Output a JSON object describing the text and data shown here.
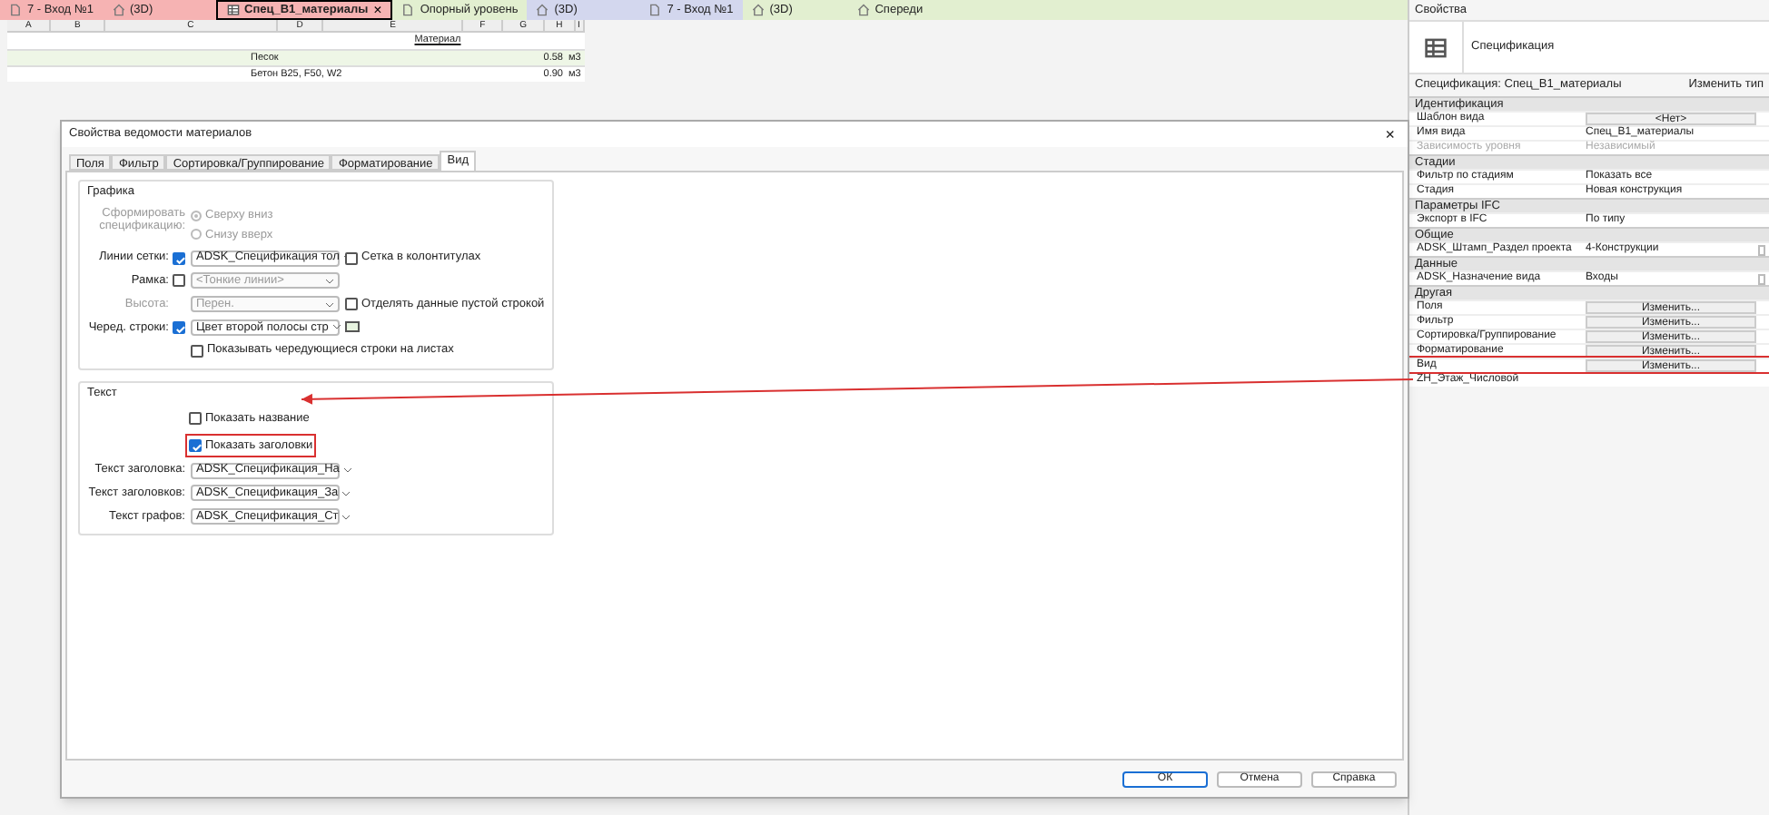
{
  "tabs": [
    {
      "label": "7 - Вход №1",
      "selected": false,
      "color": "#f6b3b3",
      "kind": "sheet"
    },
    {
      "label": "(3D)",
      "selected": false,
      "color": "#f6b3b3",
      "kind": "view3d"
    },
    {
      "label": "Спец_В1_материалы",
      "selected": true,
      "color": "#f6b3b3",
      "kind": "schedule",
      "close": "×"
    },
    {
      "label": "Опорный уровень",
      "selected": false,
      "color": "#e2efd0",
      "kind": "sheet"
    },
    {
      "label": "(3D)",
      "selected": false,
      "color": "#d3d7ee",
      "kind": "view3d"
    },
    {
      "label": "7 - Вход №1",
      "selected": false,
      "color": "#d3d7ee",
      "kind": "sheet"
    },
    {
      "label": "(3D)",
      "selected": false,
      "color": "#e2efd0",
      "kind": "view3d"
    },
    {
      "label": "Спереди",
      "selected": false,
      "color": "#e2efd0",
      "kind": "view3d"
    }
  ],
  "schedule": {
    "columns": [
      "A",
      "B",
      "C",
      "D",
      "E",
      "F",
      "G",
      "H",
      "I"
    ],
    "header": "Материал",
    "rows": [
      {
        "name": "Песок",
        "value": "0.58",
        "unit": "м3"
      },
      {
        "name": "Бетон B25, F50, W2",
        "value": "0.90",
        "unit": "м3"
      }
    ]
  },
  "dialog": {
    "title": "Свойства ведомости материалов",
    "close": "×",
    "tabs": [
      {
        "label": "Поля",
        "selected": false
      },
      {
        "label": "Фильтр",
        "selected": false
      },
      {
        "label": "Сортировка/Группирование",
        "selected": false
      },
      {
        "label": "Форматирование",
        "selected": false
      },
      {
        "label": "Вид",
        "selected": true
      }
    ],
    "graphics": {
      "title": "Графика",
      "order_label": "Сформировать спецификацию:",
      "order_options": [
        {
          "label": "Сверху вниз",
          "selected": true
        },
        {
          "label": "Снизу вверх",
          "selected": false
        }
      ],
      "rows": [
        {
          "label": "Линии сетки:",
          "checked": true,
          "disabled": false,
          "value": "ADSK_Спецификация тол",
          "value_disabled": false,
          "option": {
            "label": "Сетка в колонтитулах",
            "checked": false
          }
        },
        {
          "label": "Рамка:",
          "checked": false,
          "disabled": false,
          "value": "<Тонкие линии>",
          "value_disabled": true
        },
        {
          "label": "Высота:",
          "disabled": true,
          "value": "Перен.",
          "value_disabled": true,
          "option": {
            "label": "Отделять данные пустой строкой",
            "checked": false
          }
        },
        {
          "label": "Черед. строки:",
          "checked": true,
          "disabled": false,
          "value": "Цвет второй полосы стр",
          "value_disabled": false,
          "color": "#e8f4e0"
        }
      ],
      "alt_rows": {
        "label": "Показывать чередующиеся строки на листах",
        "checked": false
      }
    },
    "text": {
      "title": "Текст",
      "options": [
        {
          "label": "Показать название",
          "checked": false,
          "highlighted": false
        },
        {
          "label": "Показать заголовки",
          "checked": true,
          "highlighted": true
        }
      ],
      "fields": [
        {
          "label": "Текст заголовка:",
          "value": "ADSK_Спецификация_На"
        },
        {
          "label": "Текст заголовков:",
          "value": "ADSK_Спецификация_За"
        },
        {
          "label": "Текст графов:",
          "value": "ADSK_Спецификация_Ст"
        }
      ]
    },
    "buttons": [
      {
        "label": "ОК",
        "default": true
      },
      {
        "label": "Отмена",
        "default": false
      },
      {
        "label": "Справка",
        "default": false
      }
    ]
  },
  "properties": {
    "title": "Свойства",
    "type": "Спецификация",
    "selector": "Спецификация: Спец_В1_материалы",
    "edit_type": "Изменить тип",
    "sections": [
      {
        "title": "Идентификация",
        "rows": [
          {
            "name": "Шаблон вида",
            "value": "<Нет>",
            "kind": "button"
          },
          {
            "name": "Имя вида",
            "value": "Спец_В1_материалы",
            "kind": "text"
          },
          {
            "name": "Зависимость уровня",
            "value": "Независимый",
            "kind": "text",
            "disabled": true
          }
        ]
      },
      {
        "title": "Стадии",
        "rows": [
          {
            "name": "Фильтр по стадиям",
            "value": "Показать все",
            "kind": "text"
          },
          {
            "name": "Стадия",
            "value": "Новая конструкция",
            "kind": "text"
          }
        ]
      },
      {
        "title": "Параметры IFC",
        "rows": [
          {
            "name": "Экспорт в IFC",
            "value": "По типу",
            "kind": "text"
          }
        ]
      },
      {
        "title": "Общие",
        "rows": [
          {
            "name": "ADSK_Штамп_Раздел проекта",
            "value": "4-Конструкции",
            "kind": "text",
            "tick": true
          }
        ]
      },
      {
        "title": "Данные",
        "rows": [
          {
            "name": "ADSK_Назначение вида",
            "value": "Входы",
            "kind": "text",
            "tick": true
          }
        ]
      },
      {
        "title": "Другая",
        "rows": [
          {
            "name": "Поля",
            "value": "Изменить...",
            "kind": "button"
          },
          {
            "name": "Фильтр",
            "value": "Изменить...",
            "kind": "button"
          },
          {
            "name": "Сортировка/Группирование",
            "value": "Изменить...",
            "kind": "button"
          },
          {
            "name": "Форматирование",
            "value": "Изменить...",
            "kind": "button"
          },
          {
            "name": "Вид",
            "value": "Изменить...",
            "kind": "button",
            "highlighted": true
          },
          {
            "name": "ZH_Этаж_Числовой"
          }
        ]
      }
    ]
  }
}
